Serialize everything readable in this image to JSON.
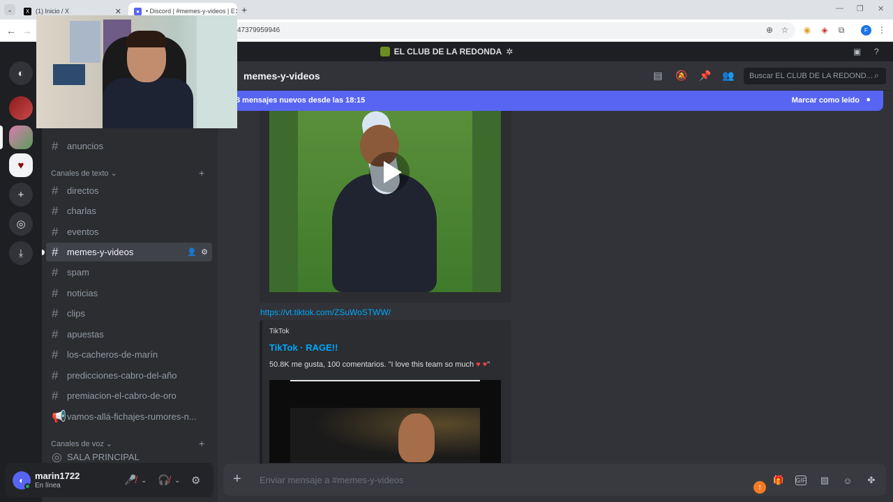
{
  "browser": {
    "tabs": [
      {
        "title": "(1) Inicio / X"
      },
      {
        "title": "• Discord | #memes-y-videos | E"
      }
    ],
    "url_visible": "47379959946"
  },
  "server": {
    "name": "EL CLUB DE LA REDONDA"
  },
  "sidebar": {
    "partial_top_label": "anuncios",
    "text_category": "Canales de texto",
    "voice_category": "Canales de voz",
    "channels": [
      {
        "name": "directos"
      },
      {
        "name": "charlas"
      },
      {
        "name": "eventos"
      },
      {
        "name": "memes-y-videos"
      },
      {
        "name": "spam"
      },
      {
        "name": "noticias"
      },
      {
        "name": "clips"
      },
      {
        "name": "apuestas"
      },
      {
        "name": "los-cacheros-de-marín"
      },
      {
        "name": "predicciones-cabro-del-año"
      },
      {
        "name": "premiacion-el-cabro-de-oro"
      },
      {
        "name": "vamos-allá-fichajes-rumores-n..."
      }
    ],
    "voice_channel": "SALA PRINCIPAL"
  },
  "user": {
    "name": "marin1722",
    "status": "En línea"
  },
  "channel_header": {
    "title": "memes-y-videos",
    "search_placeholder": "Buscar EL CLUB DE LA REDOND..."
  },
  "new_messages_bar": {
    "text": "3 mensajes nuevos desde las 18:15",
    "action": "Marcar como leído"
  },
  "messages": {
    "link": "https://vt.tiktok.com/ZSuWoSTWW/",
    "embed": {
      "provider": "TikTok",
      "title": "TikTok · RAGE!!",
      "description": "50.8K me gusta, 100 comentarios. \"I love this team so much ",
      "description_end": "\""
    }
  },
  "composer": {
    "placeholder": "Enviar mensaje a #memes-y-videos"
  },
  "colors": {
    "blurple": "#5865f2",
    "link": "#00a8fc",
    "online": "#23a55a",
    "muted_red": "#f23f43"
  },
  "icons": [
    "discord-icon",
    "hash-icon",
    "threads-icon",
    "mute-icon",
    "pin-icon",
    "members-icon",
    "search-icon",
    "play-icon",
    "gift-icon",
    "gif-icon",
    "sticker-icon",
    "emoji-icon",
    "apps-icon",
    "settings-icon",
    "inbox-icon",
    "help-icon",
    "add-icon",
    "download-icon",
    "explore-icon"
  ]
}
